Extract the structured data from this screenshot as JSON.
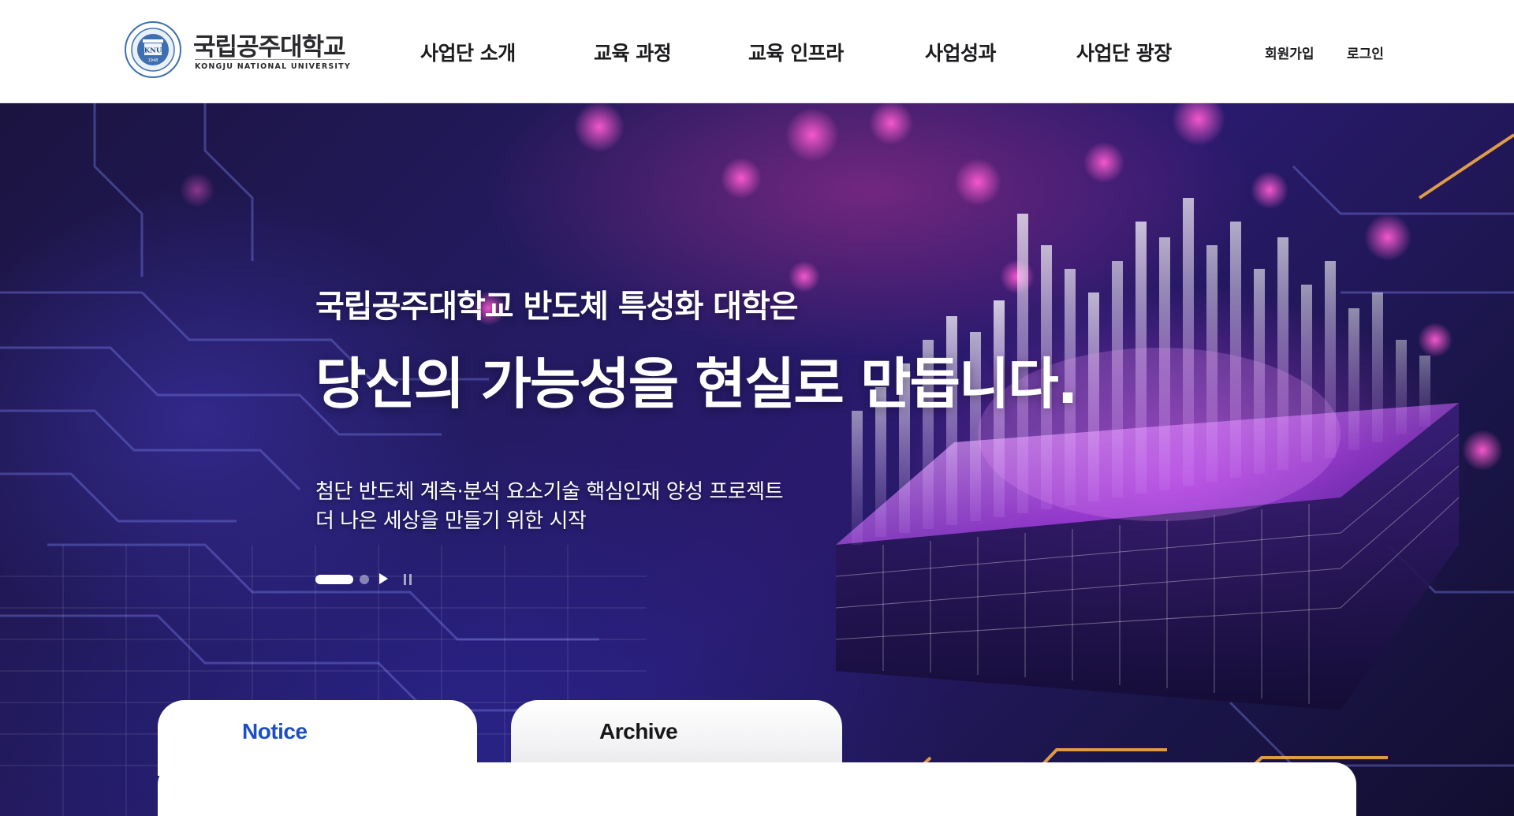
{
  "header": {
    "logo": {
      "name_ko": "국립공주대학교",
      "name_en": "KONGJU NATIONAL UNIVERSITY",
      "emblem_text": "KNU",
      "emblem_year": "1948"
    },
    "nav": [
      {
        "label": "사업단 소개"
      },
      {
        "label": "교육 과정"
      },
      {
        "label": "교육 인프라"
      },
      {
        "label": "사업성과"
      },
      {
        "label": "사업단 광장"
      }
    ],
    "utility": {
      "signup": "회원가입",
      "login": "로그인"
    }
  },
  "hero": {
    "subtitle": "국립공주대학교 반도체 특성화 대학은",
    "title": "당신의 가능성을 현실로 만듭니다.",
    "description_line1": "첨단 반도체 계측·분석 요소기술 핵심인재 양성 프로젝트",
    "description_line2": "더 나은 세상을 만들기 위한 시작",
    "slider": {
      "slide_count": 2,
      "active_slide": 1,
      "play_icon": "play-icon",
      "pause_icon": "pause-icon"
    }
  },
  "tabs": [
    {
      "label": "Notice",
      "active": true
    },
    {
      "label": "Archive",
      "active": false
    }
  ],
  "colors": {
    "accent": "#1d4fc4",
    "nav_text": "#1c1c1f",
    "hero_glow": "#d646ff"
  }
}
